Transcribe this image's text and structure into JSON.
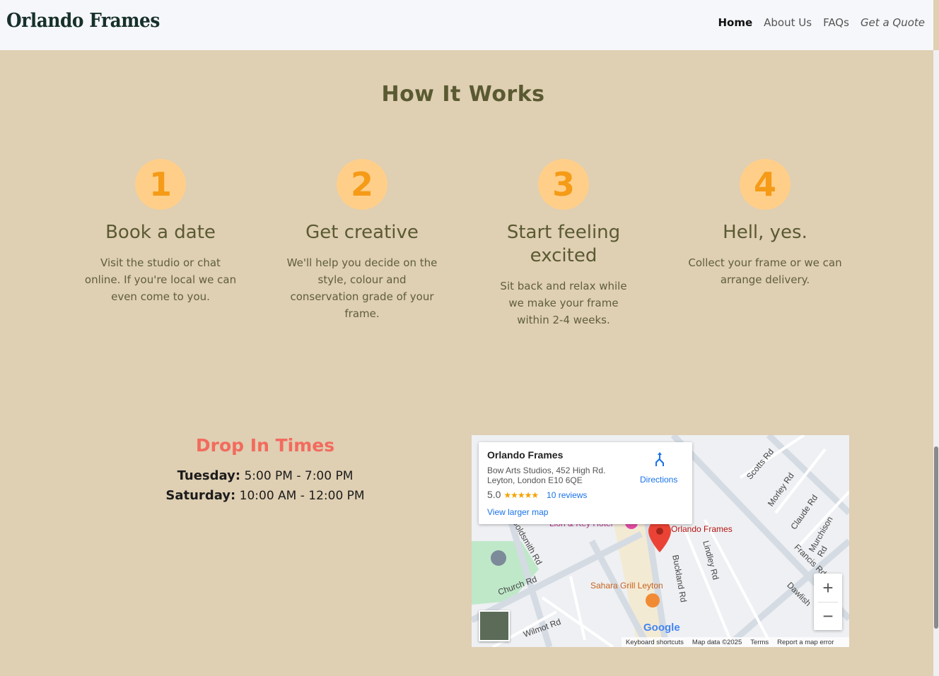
{
  "header": {
    "logo": "Orlando Frames",
    "nav": [
      {
        "label": "Home"
      },
      {
        "label": "About Us"
      },
      {
        "label": "FAQs"
      },
      {
        "label": "Get a Quote"
      }
    ]
  },
  "how_it_works": {
    "title": "How It Works",
    "steps": [
      {
        "number": "1",
        "heading": "Book a date",
        "text": "Visit the studio or chat online. If you're local we can even come to you."
      },
      {
        "number": "2",
        "heading": "Get creative",
        "text": "We'll help you decide on the style, colour and conservation grade of your frame."
      },
      {
        "number": "3",
        "heading": "Start feeling excited",
        "text": "Sit back and relax while we make your frame within 2-4 weeks."
      },
      {
        "number": "4",
        "heading": "Hell, yes.",
        "text": "Collect your frame or we can arrange delivery."
      }
    ]
  },
  "drop_in": {
    "title": "Drop In Times",
    "rows": [
      {
        "day": "Tuesday:",
        "time": "5:00 PM - 7:00 PM"
      },
      {
        "day": "Saturday:",
        "time": "10:00 AM - 12:00 PM"
      }
    ]
  },
  "map": {
    "place_name": "Orlando Frames",
    "address_line1": "Bow Arts Studios, 452 High Rd.",
    "address_line2": "Leyton, London E10 6QE",
    "rating": "5.0",
    "stars": "★★★★★",
    "reviews": "10 reviews",
    "larger_map": "View larger map",
    "directions": "Directions",
    "zoom_in": "+",
    "zoom_out": "−",
    "google": "Google",
    "footer": [
      "Keyboard shortcuts",
      "Map data ©2025",
      "Terms",
      "Report a map error"
    ],
    "labels": {
      "pin": "Orlando Frames",
      "sahara": "Sahara Grill Leyton",
      "lion": "Lion & Key Hotel",
      "church": "Church Rd",
      "goldsmith": "Goldsmith Rd",
      "buckland": "Buckland Rd",
      "lindley": "Lindley Rd",
      "scotts": "Scotts Rd",
      "morley": "Morley Rd",
      "claude": "Claude Rd",
      "murchison": "Murchison Rd",
      "francis": "Francis Rd",
      "dawlish": "Dawlish",
      "wilmot": "Wilmot Rd"
    }
  },
  "colors": {
    "background": "#dfcfb3",
    "accent_orange": "#f59b17",
    "circle_bg": "#ffcf8a",
    "drop_title": "#f26b5e",
    "heading": "#5a5a32"
  }
}
